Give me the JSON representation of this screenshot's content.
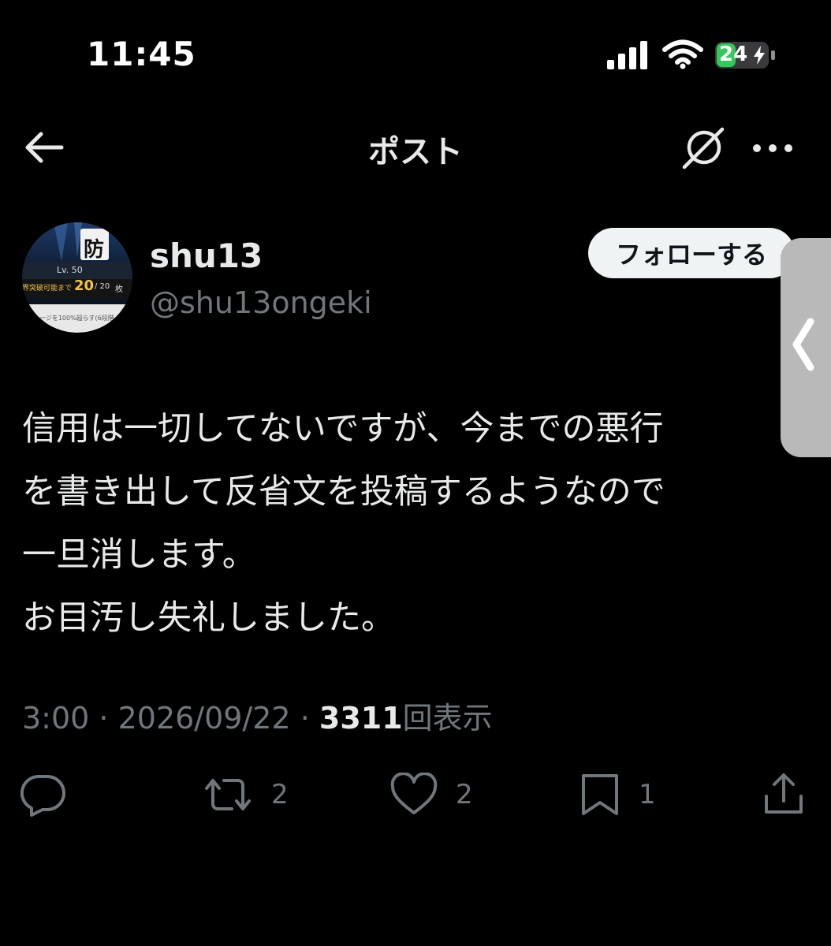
{
  "status_bar": {
    "time": "11:45",
    "battery": "24"
  },
  "nav": {
    "title": "ポスト"
  },
  "author": {
    "display_name": "shu13",
    "handle": "@shu13ongeki",
    "follow_label": "フォローする",
    "avatar": {
      "badge": "防",
      "level": "Lv. 50",
      "progress_label": "界突破可能まで",
      "progress_value": "20",
      "progress_max": "/ 20",
      "progress_unit": "枚",
      "footer": "ージを100%超らす(6段階"
    }
  },
  "post": {
    "lines": [
      "信用は一切してないですが、今までの悪行",
      "を書き出して反省文を投稿するようなので",
      "一旦消します。",
      "お目汚し失礼しました。"
    ]
  },
  "meta": {
    "time": "3:00",
    "date": "2026/09/22",
    "views": "3311",
    "views_label": "回表示",
    "separator": " · "
  },
  "actions": {
    "replies": "",
    "reposts": "2",
    "likes": "2",
    "bookmarks": "1"
  }
}
